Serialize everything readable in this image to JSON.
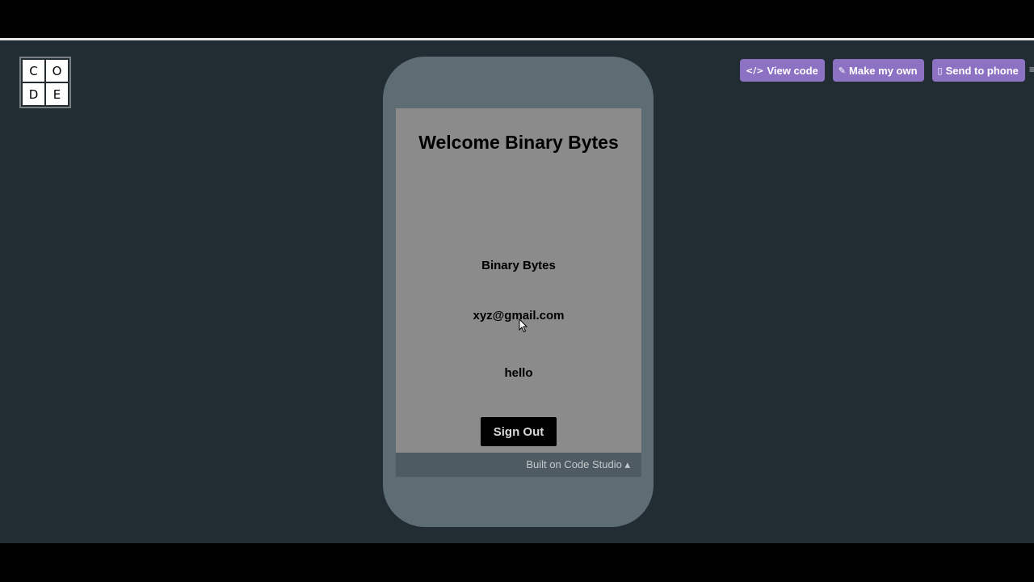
{
  "logo": {
    "letters": [
      "C",
      "O",
      "D",
      "E"
    ]
  },
  "actions": {
    "view_code": "View code",
    "make_my_own": "Make my own",
    "send_to_phone": "Send to phone"
  },
  "app": {
    "title": "Welcome Binary Bytes",
    "name": "Binary Bytes",
    "email": "xyz@gmail.com",
    "message": "hello",
    "sign_out": "Sign Out"
  },
  "footer": {
    "built_on": "Built on Code Studio ▴"
  },
  "colors": {
    "background": "#212c33",
    "phone_frame": "#5e6c73",
    "screen": "#8b8b8b",
    "button_accent": "#8d72c4"
  }
}
